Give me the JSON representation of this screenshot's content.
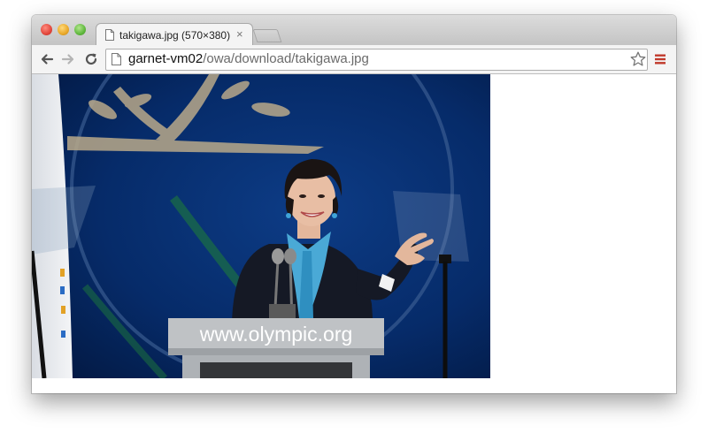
{
  "browser": {
    "tab": {
      "title": "takigawa.jpg (570×380)",
      "close_glyph": "×",
      "icon": "page-icon"
    },
    "address_bar": {
      "host": "garnet-vm02",
      "path": "/owa/download/takigawa.jpg",
      "page_icon": "page-icon"
    },
    "buttons": {
      "back": "back-arrow-icon",
      "forward": "forward-arrow-icon",
      "reload": "reload-icon",
      "bookmark": "star-icon",
      "menu": "hamburger-menu-icon"
    },
    "colors": {
      "menu_accent": "#c0392b",
      "titlebar": "#cfcfcf",
      "toolbar": "#f4f4f4"
    }
  },
  "image": {
    "podium_text": "www.olympic.org"
  }
}
